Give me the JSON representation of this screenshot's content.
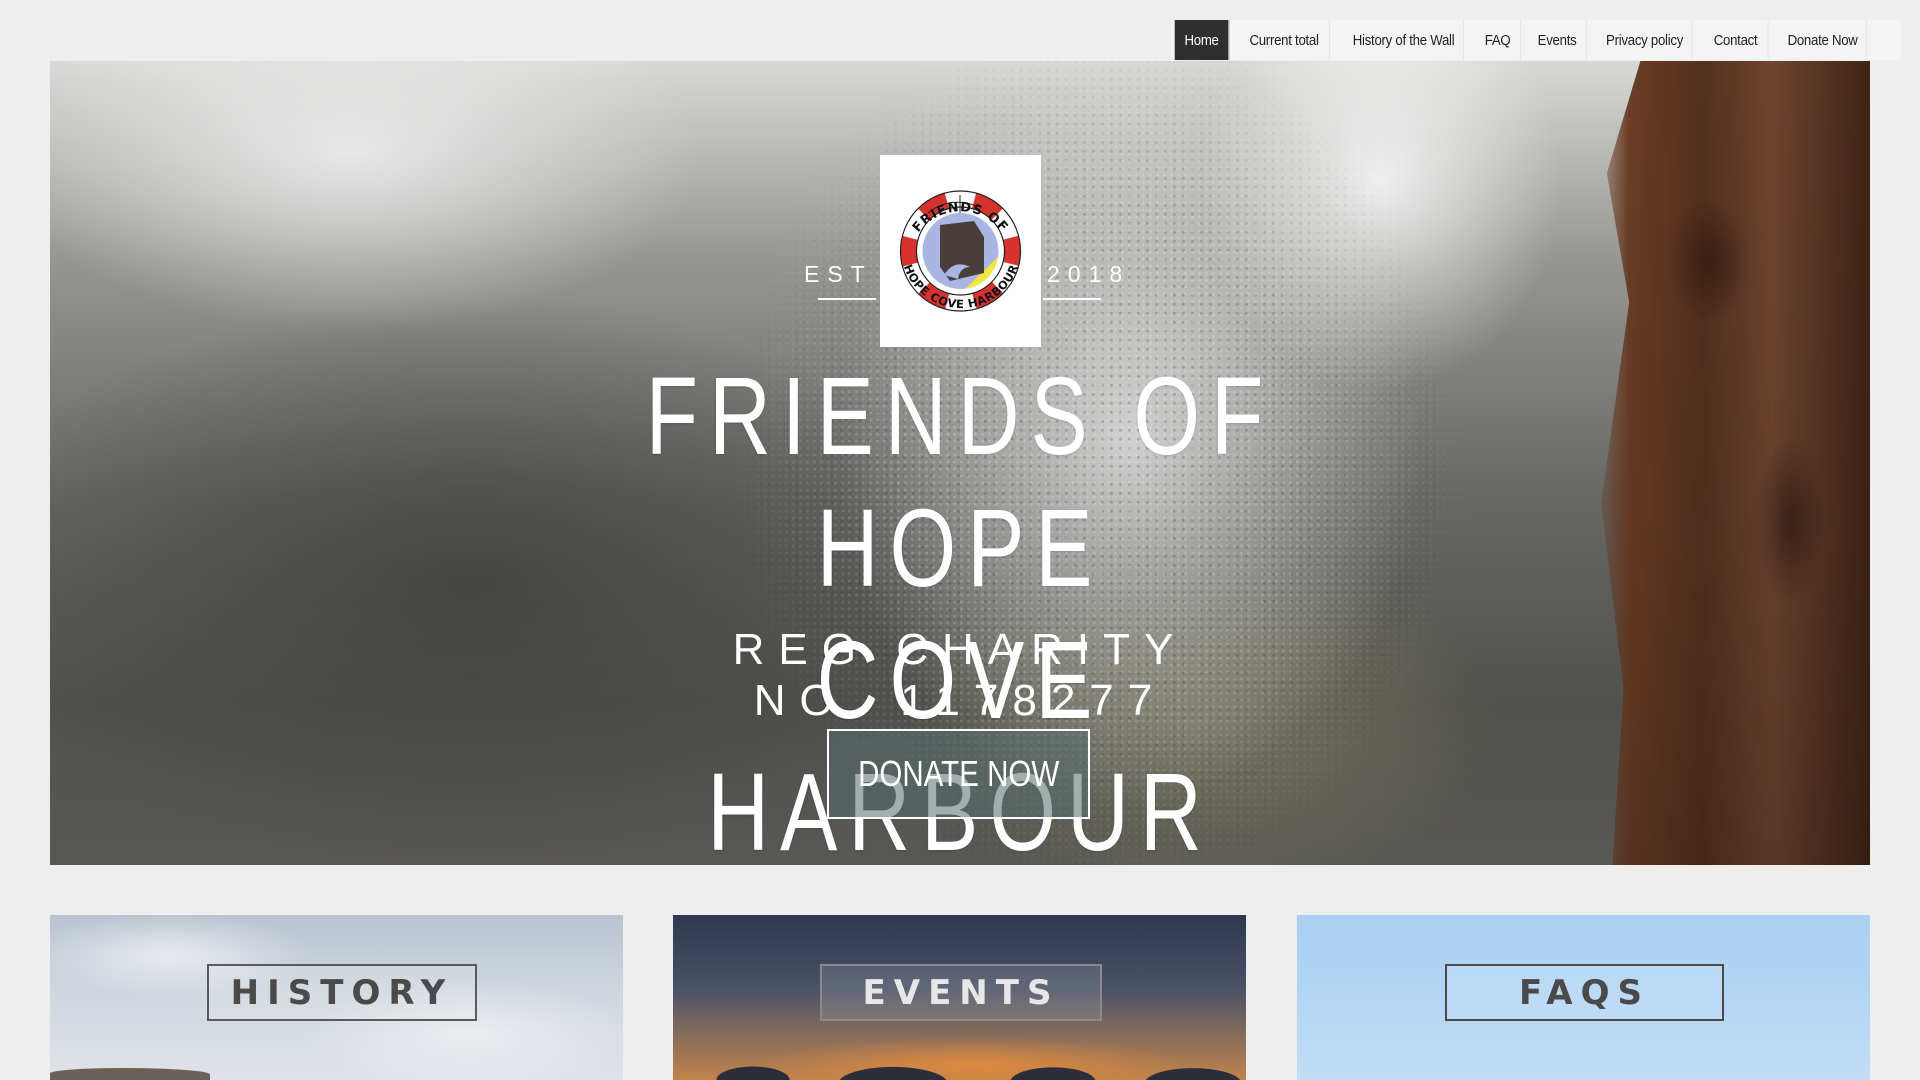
{
  "nav": {
    "items": [
      {
        "label": "Home",
        "active": true
      },
      {
        "label": "Current total"
      },
      {
        "label": "History of the Wall"
      },
      {
        "label": "FAQ"
      },
      {
        "label": "Events"
      },
      {
        "label": "Privacy policy"
      },
      {
        "label": "Contact"
      },
      {
        "label": "Donate Now"
      }
    ]
  },
  "hero": {
    "est_left": "EST",
    "est_right": "2018",
    "logo": {
      "top_text": "FRIENDS OF",
      "bottom_text": "HOPE COVE HARBOUR",
      "colors": {
        "ring_red": "#d8322f",
        "water_blue": "#a9b6e3",
        "sand_yellow": "#f2e640",
        "house": "#4a3e3a"
      }
    },
    "title_line1": "FRIENDS OF HOPE",
    "title_line2": "COVE HARBOUR",
    "charity_line1": "REG CHARITY",
    "charity_line2": "NO. 1178277",
    "donate_label": "DONATE NOW"
  },
  "cards": [
    {
      "label": "HISTORY"
    },
    {
      "label": "EVENTS"
    },
    {
      "label": "FAQS"
    }
  ],
  "colors": {
    "page_bg": "#eeeeee",
    "nav_active_bg": "#2f2f2f",
    "nav_bg": "#f4f4f4"
  }
}
